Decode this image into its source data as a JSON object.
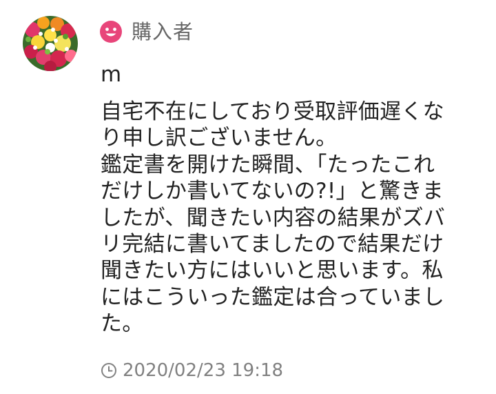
{
  "review": {
    "role_label": "購入者",
    "username": "m",
    "comment": "自宅不在にしており受取評価遅くな\nり申し訳ございません。\n鑑定書を開けた瞬間、「たったこれ\nだけしか書いてないの?!」と驚きま\nしたが、聞きたい内容の結果がズバ\nリ完結に書いてましたので結果だけ\n聞きたい方にはいいと思います。私\nにはこういった鑑定は合っていまし\nた。",
    "timestamp": "2020/02/23 19:18"
  },
  "icons": {
    "role": "smile-icon",
    "time": "clock-icon",
    "avatar": "flower-bouquet-avatar"
  },
  "colors": {
    "accent_pink": "#e8457a",
    "muted_text": "#808080",
    "role_text": "#666666",
    "body_text": "#222222"
  }
}
